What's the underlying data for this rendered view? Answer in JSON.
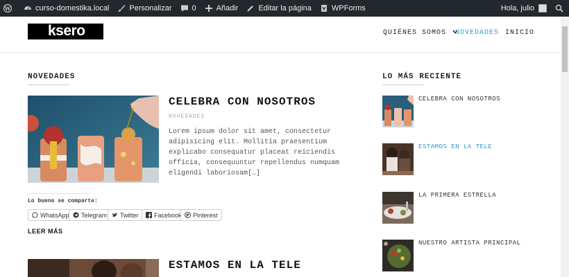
{
  "adminbar": {
    "site": "curso-domestika.local",
    "customize": "Personalizar",
    "comments_count": "0",
    "add": "Añadir",
    "edit_page": "Editar la página",
    "wpforms": "WPForms",
    "greeting": "Hola, julio"
  },
  "header": {
    "logo": "ksero",
    "nav": [
      "QUIÉNES SOMOS",
      "NOVEDADES",
      "INICIO"
    ],
    "active_color": "#2a9fc9"
  },
  "main": {
    "section_title": "NOVEDADES",
    "posts": [
      {
        "title": "CELEBRA CON NOSOTROS",
        "category": "NOVEDADES",
        "excerpt": "Lorem ipsum dolor sit amet, consectetur adipisicing elit. Mollitia praesentium explicabo consequatur placeat reiciendis officia, consequuntur repellendus numquam eligendi laboriosam[…]"
      },
      {
        "title": "ESTAMOS EN LA TELE"
      }
    ],
    "share": {
      "label": "Lo bueno se comparte:",
      "buttons": [
        "WhatsApp",
        "Telegram",
        "Twitter",
        "Facebook",
        "Pinterest"
      ]
    },
    "read_more": "LEER MÁS"
  },
  "sidebar": {
    "title": "LO MÁS RECIENTE",
    "items": [
      {
        "title": "CELEBRA CON NOSOTROS"
      },
      {
        "title": "ESTAMOS EN LA TELE"
      },
      {
        "title": "LA PRIMERA ESTRELLA"
      },
      {
        "title": "NUESTRO ARTISTA PRINCIPAL"
      }
    ]
  }
}
